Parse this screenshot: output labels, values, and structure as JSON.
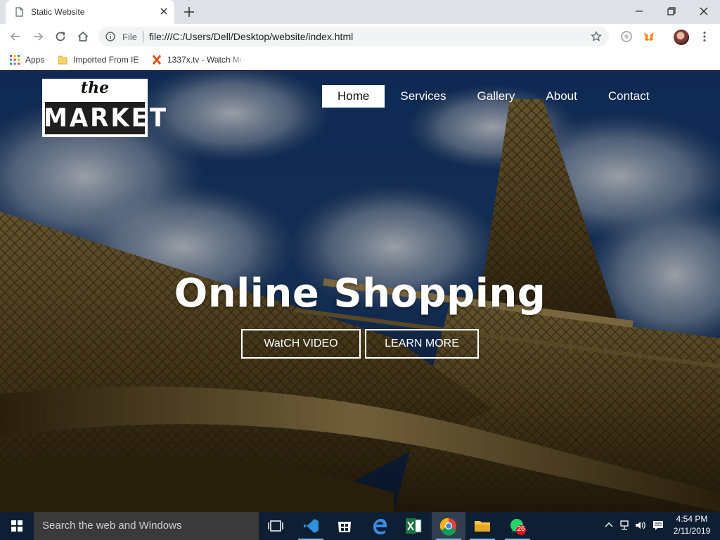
{
  "browser": {
    "tab_title": "Static Website",
    "address_scheme": "File",
    "address_url": "file:///C:/Users/Dell/Desktop/website/index.html",
    "bookmarks": [
      {
        "label": "Apps",
        "icon": "apps-grid-icon"
      },
      {
        "label": "Imported From IE",
        "icon": "folder-icon"
      },
      {
        "label": "1337x.tv - Watch Mo",
        "icon": "x-logo-icon"
      }
    ]
  },
  "site": {
    "logo": {
      "top": "the",
      "bottom": "MARKET"
    },
    "nav": [
      {
        "label": "Home",
        "active": true
      },
      {
        "label": "Services"
      },
      {
        "label": "Gallery"
      },
      {
        "label": "About"
      },
      {
        "label": "Contact"
      }
    ],
    "headline": "Online Shopping",
    "buttons": {
      "watch": "WatCH VIDEO",
      "learn": "LEARN MORE"
    }
  },
  "taskbar": {
    "search_placeholder": "Search the web and Windows",
    "whatsapp_badge": "26",
    "time": "4:54 PM",
    "date": "2/11/2019"
  },
  "colors": {
    "taskbar": "#0e1f33",
    "chrome_bg": "#dee1e6",
    "accent": "#76b9ed"
  }
}
